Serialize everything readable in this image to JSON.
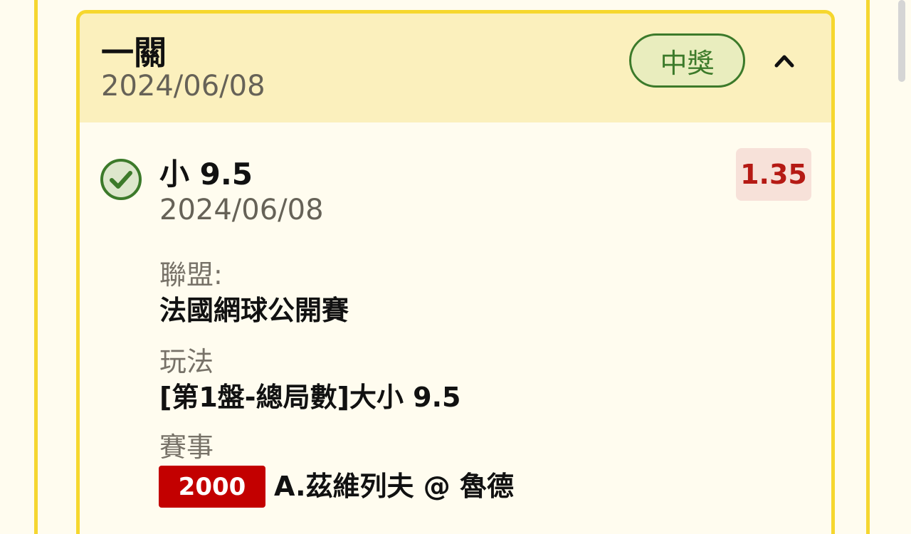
{
  "card": {
    "title": "一關",
    "date": "2024/06/08",
    "status": "中獎",
    "collapse_icon": "chevron-up-icon"
  },
  "bet": {
    "check_icon": "check-circle-icon",
    "selection": "小 9.5",
    "date": "2024/06/08",
    "odds": "1.35",
    "league_label": "聯盟:",
    "league": "法國網球公開賽",
    "market_label": "玩法",
    "market": "[第1盤-總局數]大小 9.5",
    "event_label": "賽事",
    "event_code": "2000",
    "event_name": "A.茲維列夫 @ 魯德"
  },
  "colors": {
    "card_border": "#f6d72e",
    "header_background": "#fbf0bd",
    "win_green": "#3c7a2a",
    "odds_red": "#b51a14",
    "event_code_red": "#c30000"
  }
}
